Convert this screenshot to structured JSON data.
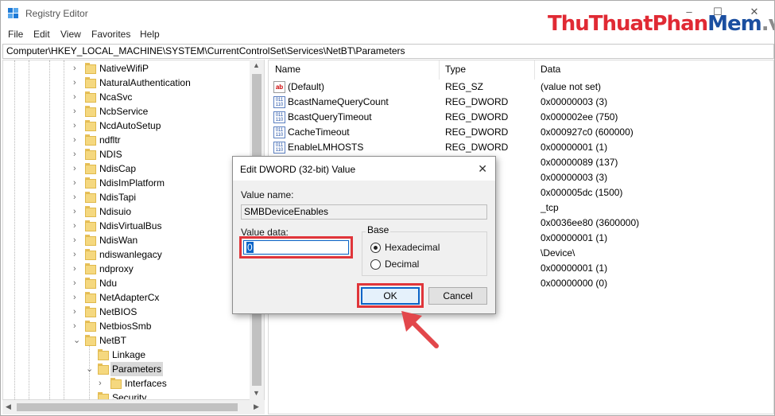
{
  "window": {
    "title": "Registry Editor",
    "watermark": {
      "part1": "Thu",
      "part2": "Thuat",
      "part3": "Phan",
      "part4": "Mem",
      "part5": ".vn"
    },
    "minimize": "–",
    "maximize": "☐",
    "close": "✕"
  },
  "menu": {
    "file": "File",
    "edit": "Edit",
    "view": "View",
    "favorites": "Favorites",
    "help": "Help"
  },
  "address": "Computer\\HKEY_LOCAL_MACHINE\\SYSTEM\\CurrentControlSet\\Services\\NetBT\\Parameters",
  "tree": {
    "items": [
      {
        "label": "NativeWifiP",
        "chevron": "›"
      },
      {
        "label": "NaturalAuthentication",
        "chevron": "›"
      },
      {
        "label": "NcaSvc",
        "chevron": "›"
      },
      {
        "label": "NcbService",
        "chevron": "›"
      },
      {
        "label": "NcdAutoSetup",
        "chevron": "›"
      },
      {
        "label": "ndfltr",
        "chevron": "›"
      },
      {
        "label": "NDIS",
        "chevron": "›"
      },
      {
        "label": "NdisCap",
        "chevron": "›"
      },
      {
        "label": "NdisImPlatform",
        "chevron": "›"
      },
      {
        "label": "NdisTapi",
        "chevron": "›"
      },
      {
        "label": "Ndisuio",
        "chevron": "›"
      },
      {
        "label": "NdisVirtualBus",
        "chevron": "›"
      },
      {
        "label": "NdisWan",
        "chevron": "›"
      },
      {
        "label": "ndiswanlegacy",
        "chevron": "›"
      },
      {
        "label": "ndproxy",
        "chevron": "›"
      },
      {
        "label": "Ndu",
        "chevron": "›"
      },
      {
        "label": "NetAdapterCx",
        "chevron": "›"
      },
      {
        "label": "NetBIOS",
        "chevron": "›"
      },
      {
        "label": "NetbiosSmb",
        "chevron": "›"
      },
      {
        "label": "NetBT",
        "chevron": "⌄"
      },
      {
        "label": "Linkage",
        "chevron": ""
      },
      {
        "label": "Parameters",
        "chevron": "⌄"
      },
      {
        "label": "Interfaces",
        "chevron": "›"
      },
      {
        "label": "Security",
        "chevron": ""
      }
    ]
  },
  "list": {
    "headers": {
      "name": "Name",
      "type": "Type",
      "data": "Data"
    },
    "rows": [
      {
        "name": "(Default)",
        "type": "REG_SZ",
        "data": "(value not set)",
        "icon": "ab"
      },
      {
        "name": "BcastNameQueryCount",
        "type": "REG_DWORD",
        "data": "0x00000003 (3)",
        "icon": "bin"
      },
      {
        "name": "BcastQueryTimeout",
        "type": "REG_DWORD",
        "data": "0x000002ee (750)",
        "icon": "bin"
      },
      {
        "name": "CacheTimeout",
        "type": "REG_DWORD",
        "data": "0x000927c0 (600000)",
        "icon": "bin"
      },
      {
        "name": "EnableLMHOSTS",
        "type": "REG_DWORD",
        "data": "0x00000001 (1)",
        "icon": "bin"
      },
      {
        "name": "",
        "type": "",
        "data": "0x00000089 (137)",
        "icon": ""
      },
      {
        "name": "",
        "type": "",
        "data": "0x00000003 (3)",
        "icon": ""
      },
      {
        "name": "",
        "type": "",
        "data": "0x000005dc (1500)",
        "icon": ""
      },
      {
        "name": "",
        "type": "",
        "data": "_tcp",
        "icon": ""
      },
      {
        "name": "",
        "type": "",
        "data": "0x0036ee80 (3600000)",
        "icon": ""
      },
      {
        "name": "",
        "type": "",
        "data": "0x00000001 (1)",
        "icon": ""
      },
      {
        "name": "",
        "type": "",
        "data": "\\Device\\",
        "icon": ""
      },
      {
        "name": "",
        "type": "",
        "data": "0x00000001 (1)",
        "icon": ""
      },
      {
        "name": "",
        "type": "",
        "data": "0x00000000 (0)",
        "icon": ""
      }
    ]
  },
  "dialog": {
    "title": "Edit DWORD (32-bit) Value",
    "close": "✕",
    "value_name_label": "Value name:",
    "value_name": "SMBDeviceEnables",
    "value_data_label": "Value data:",
    "value_data": "0",
    "base_label": "Base",
    "hex_label": "Hexadecimal",
    "dec_label": "Decimal",
    "ok": "OK",
    "cancel": "Cancel"
  },
  "colors": {
    "highlight": "#e0353a",
    "accent": "#0a64c8"
  }
}
